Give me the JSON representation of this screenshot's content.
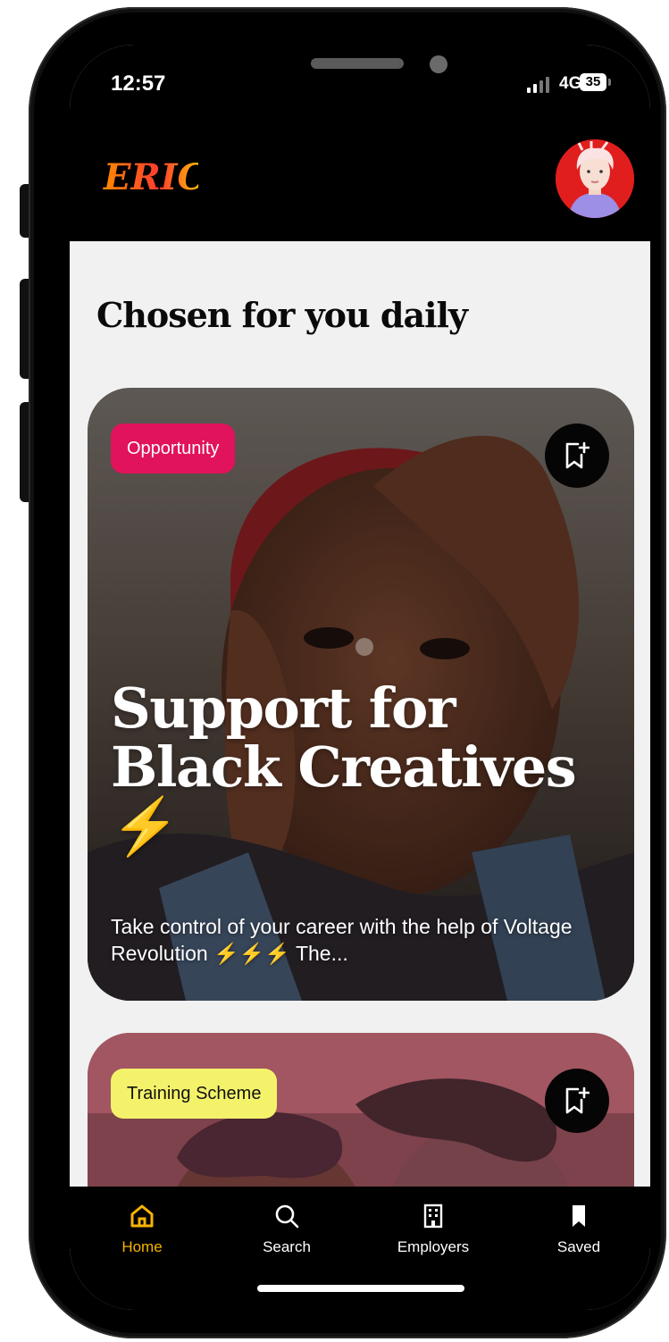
{
  "status_bar": {
    "time": "12:57",
    "network": "4G",
    "battery": "35"
  },
  "header": {
    "logo_text": "ERIC"
  },
  "main": {
    "section_title": "Chosen for you daily",
    "cards": [
      {
        "tag": "Opportunity",
        "tag_color": "#e0135c",
        "title": "Support for Black Creatives ⚡",
        "description": "Take control of your career with the help of Voltage Revolution ⚡⚡⚡ The..."
      },
      {
        "tag": "Training Scheme",
        "tag_color": "#f4f26a"
      }
    ]
  },
  "tab_bar": {
    "items": [
      {
        "label": "Home",
        "icon": "home-icon",
        "active": true
      },
      {
        "label": "Search",
        "icon": "search-icon",
        "active": false
      },
      {
        "label": "Employers",
        "icon": "building-icon",
        "active": false
      },
      {
        "label": "Saved",
        "icon": "bookmark-icon",
        "active": false
      }
    ]
  },
  "colors": {
    "accent": "#f5b400",
    "background": "#f1f1f1",
    "header": "#000000"
  }
}
